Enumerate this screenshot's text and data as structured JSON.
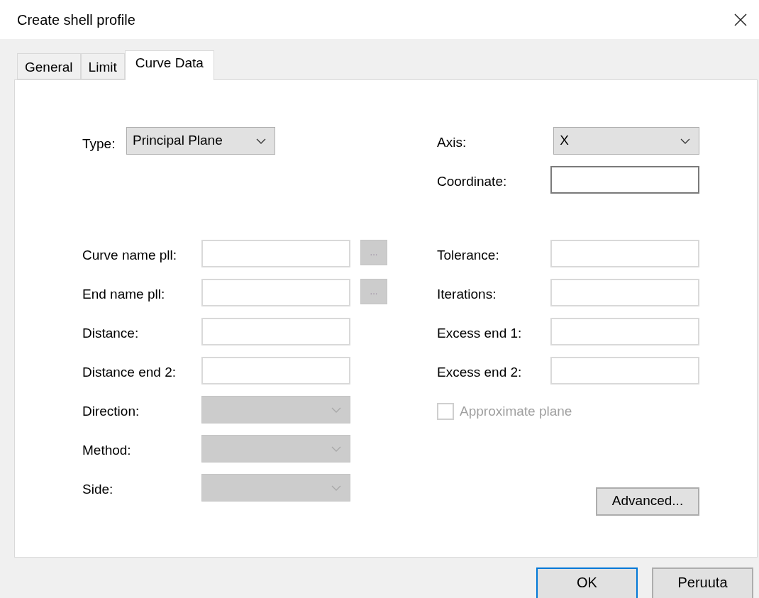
{
  "window": {
    "title": "Create shell profile"
  },
  "tabs": [
    {
      "label": "General",
      "selected": false
    },
    {
      "label": "Limit",
      "selected": false
    },
    {
      "label": "Curve Data",
      "selected": true
    }
  ],
  "type_select": {
    "label": "Type:",
    "value": "Principal Plane",
    "disabled": false
  },
  "curve_fields": [
    {
      "label": "Curve name pll:",
      "kind": "browse",
      "disabled": false,
      "browse_label": "...",
      "browse_disabled": true
    },
    {
      "label": "End name pll:",
      "kind": "browse",
      "disabled": false,
      "browse_label": "...",
      "browse_disabled": true
    },
    {
      "label": "Distance:",
      "kind": "text",
      "disabled": false
    },
    {
      "label": "Distance end 2:",
      "kind": "text",
      "disabled": false
    },
    {
      "label": "Direction:",
      "kind": "select",
      "disabled": true
    },
    {
      "label": "Method:",
      "kind": "select",
      "disabled": true
    },
    {
      "label": "Side:",
      "kind": "select",
      "disabled": true
    }
  ],
  "axis_select": {
    "label": "Axis:",
    "value": "X",
    "disabled": false
  },
  "coordinate_field": {
    "label": "Coordinate:",
    "focused": true
  },
  "solver_fields": [
    {
      "label": "Tolerance:",
      "focused": false
    },
    {
      "label": "Iterations:",
      "focused": false
    },
    {
      "label": "Excess end 1:",
      "focused": false
    },
    {
      "label": "Excess end 2:",
      "focused": false
    }
  ],
  "approximate_plane": {
    "label": "Approximate plane",
    "checked": false,
    "disabled": true
  },
  "advanced_button": {
    "label": "Advanced..."
  },
  "buttons": [
    {
      "label": "OK",
      "default": true
    },
    {
      "label": "Peruuta",
      "default": false
    }
  ]
}
